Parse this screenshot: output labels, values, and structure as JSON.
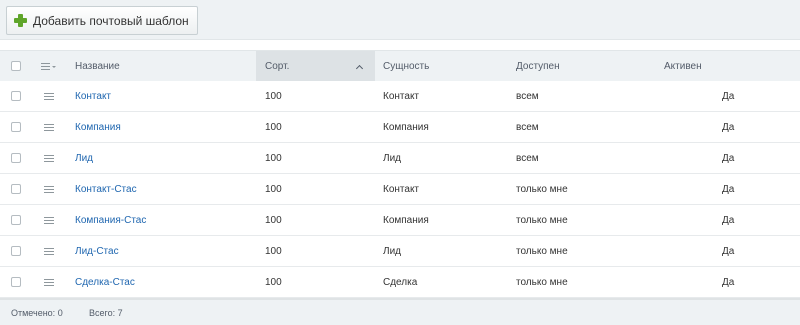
{
  "toolbar": {
    "add_button_label": "Добавить почтовый шаблон"
  },
  "table": {
    "columns": {
      "name": "Название",
      "sort": "Сорт.",
      "entity": "Сущность",
      "access": "Доступен",
      "active": "Активен"
    },
    "sorted_column": "sort",
    "rows": [
      {
        "name": "Контакт",
        "sort": "100",
        "entity": "Контакт",
        "access": "всем",
        "active": "Да"
      },
      {
        "name": "Компания",
        "sort": "100",
        "entity": "Компания",
        "access": "всем",
        "active": "Да"
      },
      {
        "name": "Лид",
        "sort": "100",
        "entity": "Лид",
        "access": "всем",
        "active": "Да"
      },
      {
        "name": "Контакт-Стас",
        "sort": "100",
        "entity": "Контакт",
        "access": "только мне",
        "active": "Да"
      },
      {
        "name": "Компания-Стас",
        "sort": "100",
        "entity": "Компания",
        "access": "только мне",
        "active": "Да"
      },
      {
        "name": "Лид-Стас",
        "sort": "100",
        "entity": "Лид",
        "access": "только мне",
        "active": "Да"
      },
      {
        "name": "Сделка-Стас",
        "sort": "100",
        "entity": "Сделка",
        "access": "только мне",
        "active": "Да"
      }
    ]
  },
  "footer": {
    "selected": "Отмечено: 0",
    "total": "Всего: 7"
  },
  "colors": {
    "link": "#2067b0",
    "accent_green": "#5fa52a",
    "panel_bg": "#eef2f4"
  }
}
